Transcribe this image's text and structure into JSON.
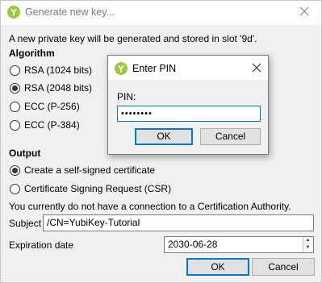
{
  "main_dialog": {
    "title": "Generate new key...",
    "intro": "A new private key will be generated and stored in slot '9d'.",
    "algorithm_heading": "Algorithm",
    "algorithms": [
      {
        "label": "RSA (1024 bits)",
        "checked": false
      },
      {
        "label": "RSA (2048 bits)",
        "checked": true
      },
      {
        "label": "ECC (P-256)",
        "checked": false
      },
      {
        "label": "ECC (P-384)",
        "checked": false
      }
    ],
    "output_heading": "Output",
    "outputs": [
      {
        "label": "Create a self-signed certificate",
        "checked": true
      },
      {
        "label": "Certificate Signing Request (CSR)",
        "checked": false
      }
    ],
    "ca_notice": "You currently do not have a connection to a Certification Authority.",
    "subject_label": "Subject",
    "subject_value": "/CN=YubiKey-Tutorial",
    "expiration_label": "Expiration date",
    "expiration_value": "2030-06-28",
    "ok_label": "OK",
    "cancel_label": "Cancel"
  },
  "pin_dialog": {
    "title": "Enter PIN",
    "pin_label": "PIN:",
    "pin_value": "••••••••",
    "ok_label": "OK",
    "cancel_label": "Cancel"
  },
  "icons": {
    "app_icon": "yubico-icon",
    "close_icon": "close-icon"
  },
  "colors": {
    "accent": "#0078d7",
    "app_icon": "#9aca3c"
  }
}
